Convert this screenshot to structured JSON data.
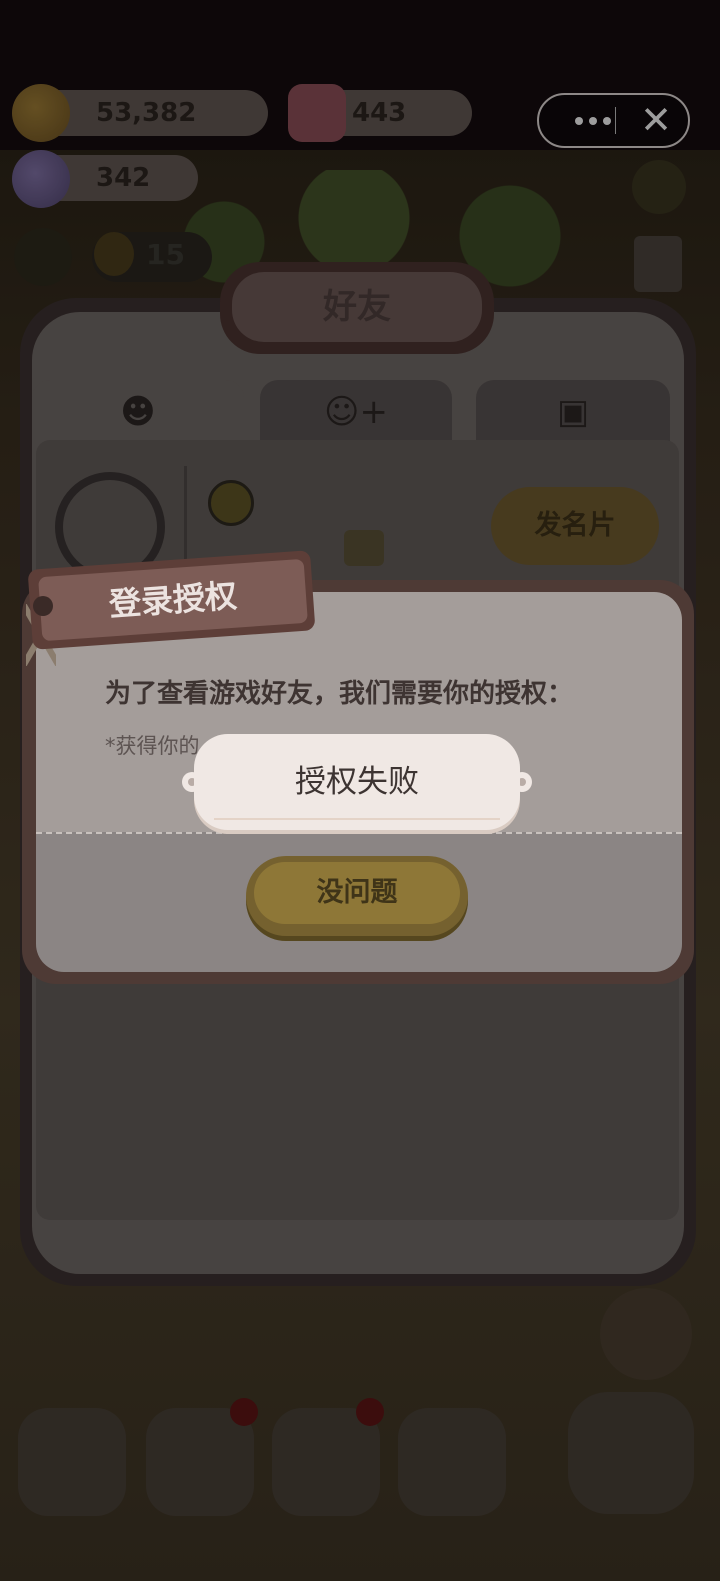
{
  "currencies": [
    {
      "name": "cookie",
      "value": "53,382",
      "icon": "cookie-coin-icon",
      "color": "#8a6a2e"
    },
    {
      "name": "gem",
      "value": "443",
      "icon": "pink-jelly-icon",
      "color": "#8a4d56"
    },
    {
      "name": "candy",
      "value": "342",
      "icon": "candy-icon",
      "color": "#6a5b86"
    }
  ],
  "level": {
    "value": "15"
  },
  "capsule": {
    "more_icon": "more-icon",
    "close_icon": "close-icon"
  },
  "friends_panel": {
    "title": "好友",
    "tabs": [
      {
        "name": "friends",
        "icon": "friends-icon",
        "glyph": "☻"
      },
      {
        "name": "add-friend",
        "icon": "add-friend-icon",
        "glyph": "☺+"
      },
      {
        "name": "bag",
        "icon": "briefcase-icon",
        "glyph": "▣"
      }
    ],
    "card_button": "发名片"
  },
  "dialog": {
    "title": "登录授权",
    "message": "为了查看游戏好友，我们需要你的授权：",
    "sub_text": "*获得你的",
    "ok_button": "没问题"
  },
  "toast": {
    "text": "授权失败"
  }
}
